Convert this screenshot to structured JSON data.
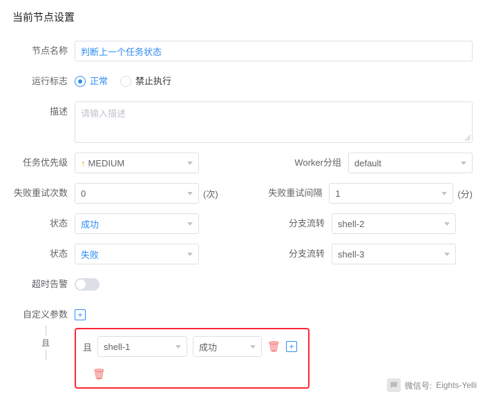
{
  "title": "当前节点设置",
  "fields": {
    "nodeName": {
      "label": "节点名称",
      "value": "判断上一个任务状态"
    },
    "runFlag": {
      "label": "运行标志",
      "options": [
        "正常",
        "禁止执行"
      ],
      "selected": "正常"
    },
    "description": {
      "label": "描述",
      "placeholder": "请输入描述"
    },
    "priority": {
      "label": "任务优先级",
      "value": "MEDIUM"
    },
    "workerGroup": {
      "label": "Worker分组",
      "value": "default"
    },
    "retryCount": {
      "label": "失败重试次数",
      "value": "0",
      "unit": "(次)"
    },
    "retryInterval": {
      "label": "失败重试间隔",
      "value": "1",
      "unit": "(分)"
    },
    "status1": {
      "label": "状态",
      "value": "成功"
    },
    "branch1": {
      "label": "分支流转",
      "value": "shell-2"
    },
    "status2": {
      "label": "状态",
      "value": "失败"
    },
    "branch2": {
      "label": "分支流转",
      "value": "shell-3"
    },
    "timeout": {
      "label": "超时告警"
    },
    "customParams": {
      "label": "自定义参数"
    },
    "and": "且"
  },
  "condition": {
    "shell": "shell-1",
    "result": "成功"
  },
  "footer": {
    "label": "微信号:",
    "value": "Eights-Yelli"
  }
}
